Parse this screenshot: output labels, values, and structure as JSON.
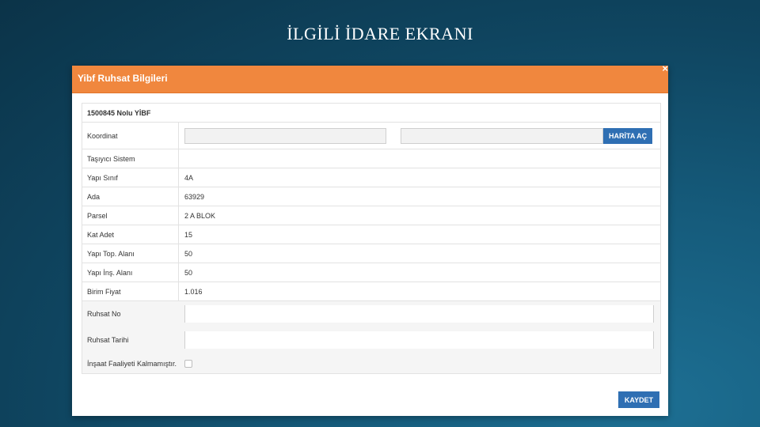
{
  "slide": {
    "title": "İLGİLİ İDARE EKRANI"
  },
  "modal": {
    "title": "Yibf Ruhsat Bilgileri",
    "close_icon": "×",
    "heading": "1500845 Nolu YİBF",
    "map_button": "HARİTA AÇ",
    "save_button": "KAYDET",
    "labels": {
      "koordinat": "Koordinat",
      "tasiyici": "Taşıyıcı Sistem",
      "yapi_sinif": "Yapı Sınıf",
      "ada": "Ada",
      "parsel": "Parsel",
      "kat_adet": "Kat Adet",
      "yapi_top_alani": "Yapı Top. Alanı",
      "yapi_ins_alani": "Yapı İnş. Alanı",
      "birim_fiyat": "Birim Fiyat",
      "ruhsat_no": "Ruhsat No",
      "ruhsat_tarihi": "Ruhsat Tarihi",
      "insaat_faaliyeti": "İnşaat Faaliyeti Kalmamıştır."
    },
    "values": {
      "tasiyici": "",
      "yapi_sinif": "4A",
      "ada": "63929",
      "parsel": "2 A BLOK",
      "kat_adet": "15",
      "yapi_top_alani": "50",
      "yapi_ins_alani": "50",
      "birim_fiyat": "1.016"
    }
  }
}
